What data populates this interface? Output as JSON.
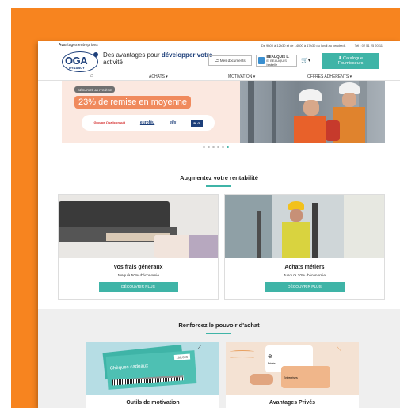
{
  "topbar": {
    "left": "Avantages entreprises",
    "hours": "De 9h00 à 12h30 et de 14h00 à 17h30 du lundi au vendredi.",
    "phone": "Tél : 02 51 25 20 11"
  },
  "header": {
    "logo_main": "OGA",
    "logo_sub": "DYNABUY",
    "tagline_prefix": "Des avantages pour ",
    "tagline_bold": "développer votre",
    "tagline_end": "activité",
    "docs_label": "Mes documents",
    "user_name": "BEAUQUIS L.",
    "user_sub": "E: BEAUQUIS Isabelle",
    "catalogue_line1": "Catalogue",
    "catalogue_line2": "Fournisseurs"
  },
  "nav": {
    "home_icon": "home-icon",
    "items": [
      "ACHATS ▾",
      "MOTIVATION ▾",
      "OFFRES ADHÉRENTS ▾"
    ]
  },
  "banner": {
    "tag": "SÉCURITÉ & HYGIÈNE",
    "headline": "23% de remise en moyenne",
    "partners": [
      "Groupe Qualiconsult",
      "euroféu",
      "elis",
      "PLG"
    ]
  },
  "section1": {
    "title": "Augmentez votre rentabilité",
    "cards": [
      {
        "title": "Vos frais généraux",
        "subtitle": "Jusqu'à 50% d'économie",
        "button": "DÉCOUVRIR PLUS"
      },
      {
        "title": "Achats métiers",
        "subtitle": "Jusqu'à 20% d'économie",
        "button": "DÉCOUVRIR PLUS"
      }
    ]
  },
  "section2": {
    "title": "Renforcez le pouvoir d'achat",
    "cards": [
      {
        "title": "Outils de motivation",
        "card_text": "Chèques cadeaux",
        "card_value": "100,00€"
      },
      {
        "title": "Avantages Privés",
        "card_text1": "Privés",
        "card_text2": "Entreprises"
      }
    ]
  },
  "colors": {
    "accent": "#3fb4a7",
    "brand": "#1d3f7a",
    "frame": "#f7841f"
  }
}
